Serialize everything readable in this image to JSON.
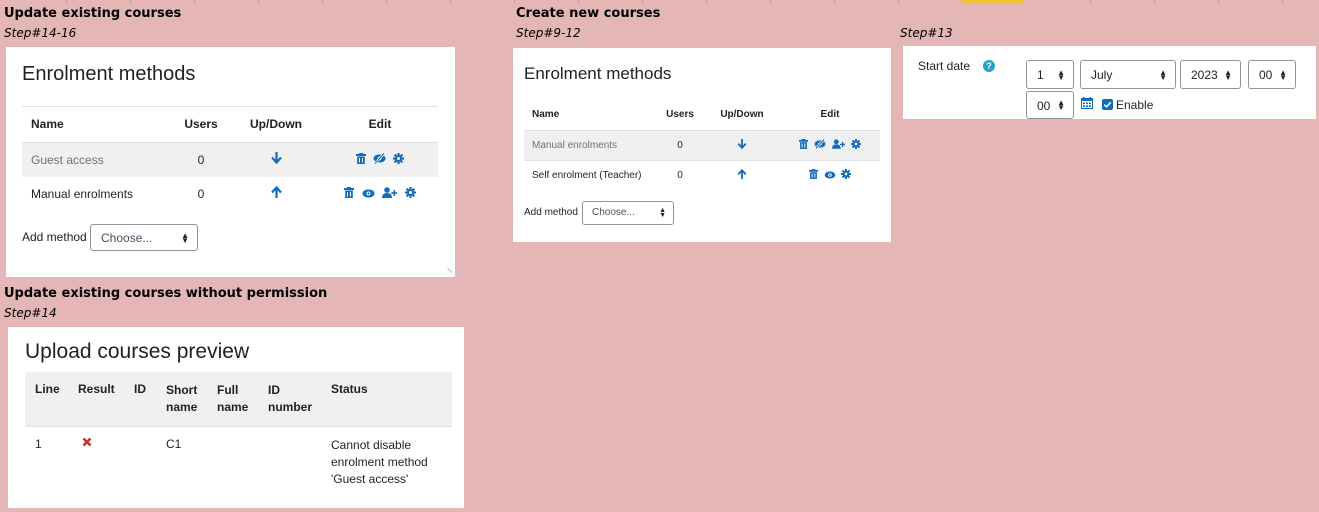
{
  "sections": {
    "update": {
      "title": "Update existing courses",
      "step": "Step#14-16"
    },
    "create": {
      "title": "Create new courses",
      "step": "Step#9-12"
    },
    "start_step": {
      "step": "Step#13"
    },
    "noperm": {
      "title": "Update existing courses without permission",
      "step": "Step#14"
    }
  },
  "panel1": {
    "heading": "Enrolment methods",
    "columns": {
      "name": "Name",
      "users": "Users",
      "updown": "Up/Down",
      "edit": "Edit"
    },
    "rows": [
      {
        "name": "Guest access",
        "users": "0",
        "arrow": "down-arrow-icon",
        "icons": [
          "trash-icon",
          "eye-slash-icon",
          "gear-icon"
        ]
      },
      {
        "name": "Manual enrolments",
        "users": "0",
        "arrow": "up-arrow-icon",
        "icons": [
          "trash-icon",
          "eye-icon",
          "user-plus-icon",
          "gear-icon"
        ]
      }
    ],
    "add_method_label": "Add method",
    "add_method_value": "Choose..."
  },
  "panel2": {
    "heading": "Enrolment methods",
    "columns": {
      "name": "Name",
      "users": "Users",
      "updown": "Up/Down",
      "edit": "Edit"
    },
    "rows": [
      {
        "name": "Manual enrolments",
        "users": "0",
        "arrow": "down-arrow-icon",
        "icons": [
          "trash-icon",
          "eye-slash-icon",
          "user-plus-icon",
          "gear-icon"
        ]
      },
      {
        "name": "Self enrolment (Teacher)",
        "users": "0",
        "arrow": "up-arrow-icon",
        "icons": [
          "trash-icon",
          "eye-icon",
          "gear-icon"
        ]
      }
    ],
    "add_method_label": "Add method",
    "add_method_value": "Choose..."
  },
  "startdate": {
    "label": "Start date",
    "day": "1",
    "month": "July",
    "year": "2023",
    "hour": "00",
    "minute": "00",
    "enable_label": "Enable",
    "enabled": true
  },
  "preview": {
    "heading": "Upload courses preview",
    "columns": {
      "line": "Line",
      "result": "Result",
      "id": "ID",
      "short_l1": "Short",
      "short_l2": "name",
      "full_l1": "Full",
      "full_l2": "name",
      "idnum_l1": "ID",
      "idnum_l2": "number",
      "status": "Status"
    },
    "row": {
      "line": "1",
      "result_icon": "cross-icon",
      "id": "",
      "short": "C1",
      "full": "",
      "idnum": "",
      "status_l1": "Cannot disable",
      "status_l2": "enrolment method",
      "status_l3": "'Guest access'"
    }
  },
  "colors": {
    "background": "#e4b6b6",
    "link_blue": "#0f6cbf",
    "error_red": "#ca3120",
    "row_highlight": "#f0f0f0"
  }
}
